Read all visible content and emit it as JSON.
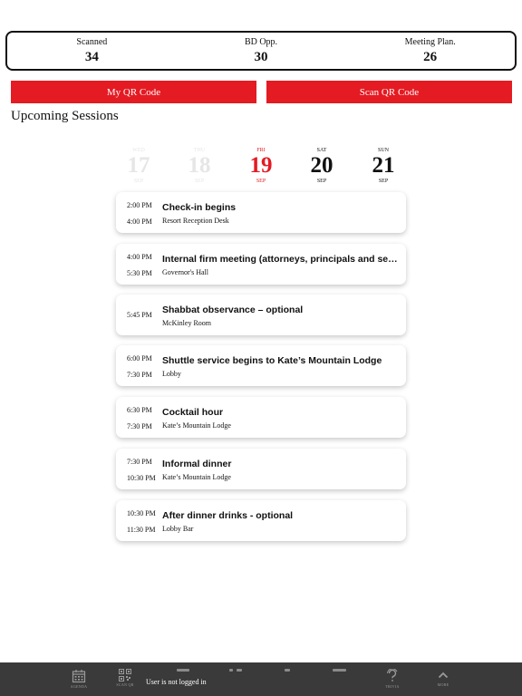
{
  "stats": [
    {
      "label": "Scanned",
      "value": "34"
    },
    {
      "label": "BD Opp.",
      "value": "30"
    },
    {
      "label": "Meeting Plan.",
      "value": "26"
    }
  ],
  "buttons": {
    "my_qr": "My QR Code",
    "scan_qr": "Scan QR Code"
  },
  "section_title": "Upcoming Sessions",
  "days": [
    {
      "dow": "WED",
      "num": "17",
      "mon": "SEP",
      "state": "faded"
    },
    {
      "dow": "THU",
      "num": "18",
      "mon": "SEP",
      "state": "faded"
    },
    {
      "dow": "FRI",
      "num": "19",
      "mon": "SEP",
      "state": "active"
    },
    {
      "dow": "SAT",
      "num": "20",
      "mon": "SEP",
      "state": "normal"
    },
    {
      "dow": "SUN",
      "num": "21",
      "mon": "SEP",
      "state": "normal"
    }
  ],
  "sessions": [
    {
      "start": "2:00 PM",
      "end": "4:00 PM",
      "title": "Check-in begins",
      "location": "Resort Reception Desk"
    },
    {
      "start": "4:00 PM",
      "end": "5:30 PM",
      "title": "Internal firm meeting (attorneys, principals and senior staff)",
      "location": "Governor's Hall"
    },
    {
      "start": "5:45 PM",
      "end": "",
      "title": "Shabbat observance – optional",
      "location": "McKinley Room"
    },
    {
      "start": "6:00 PM",
      "end": "7:30 PM",
      "title": "Shuttle service begins to Kate’s Mountain Lodge",
      "location": "Lobby"
    },
    {
      "start": "6:30 PM",
      "end": "7:30 PM",
      "title": "Cocktail hour",
      "location": "Kate’s Mountain Lodge"
    },
    {
      "start": "7:30 PM",
      "end": "10:30 PM",
      "title": "Informal dinner",
      "location": "Kate’s Mountain Lodge"
    },
    {
      "start": "10:30 PM",
      "end": "11:30 PM",
      "title": "After dinner drinks - optional",
      "location": "Lobby Bar"
    }
  ],
  "bottombar": {
    "agenda_label": "AGENDA",
    "scanqr_label": "SCAN QR",
    "trivia_label": "TRIVIA",
    "more_label": "MORE",
    "login_message": "User is not logged in"
  },
  "colors": {
    "accent": "#e41b23",
    "bar": "#3a3a3a"
  }
}
